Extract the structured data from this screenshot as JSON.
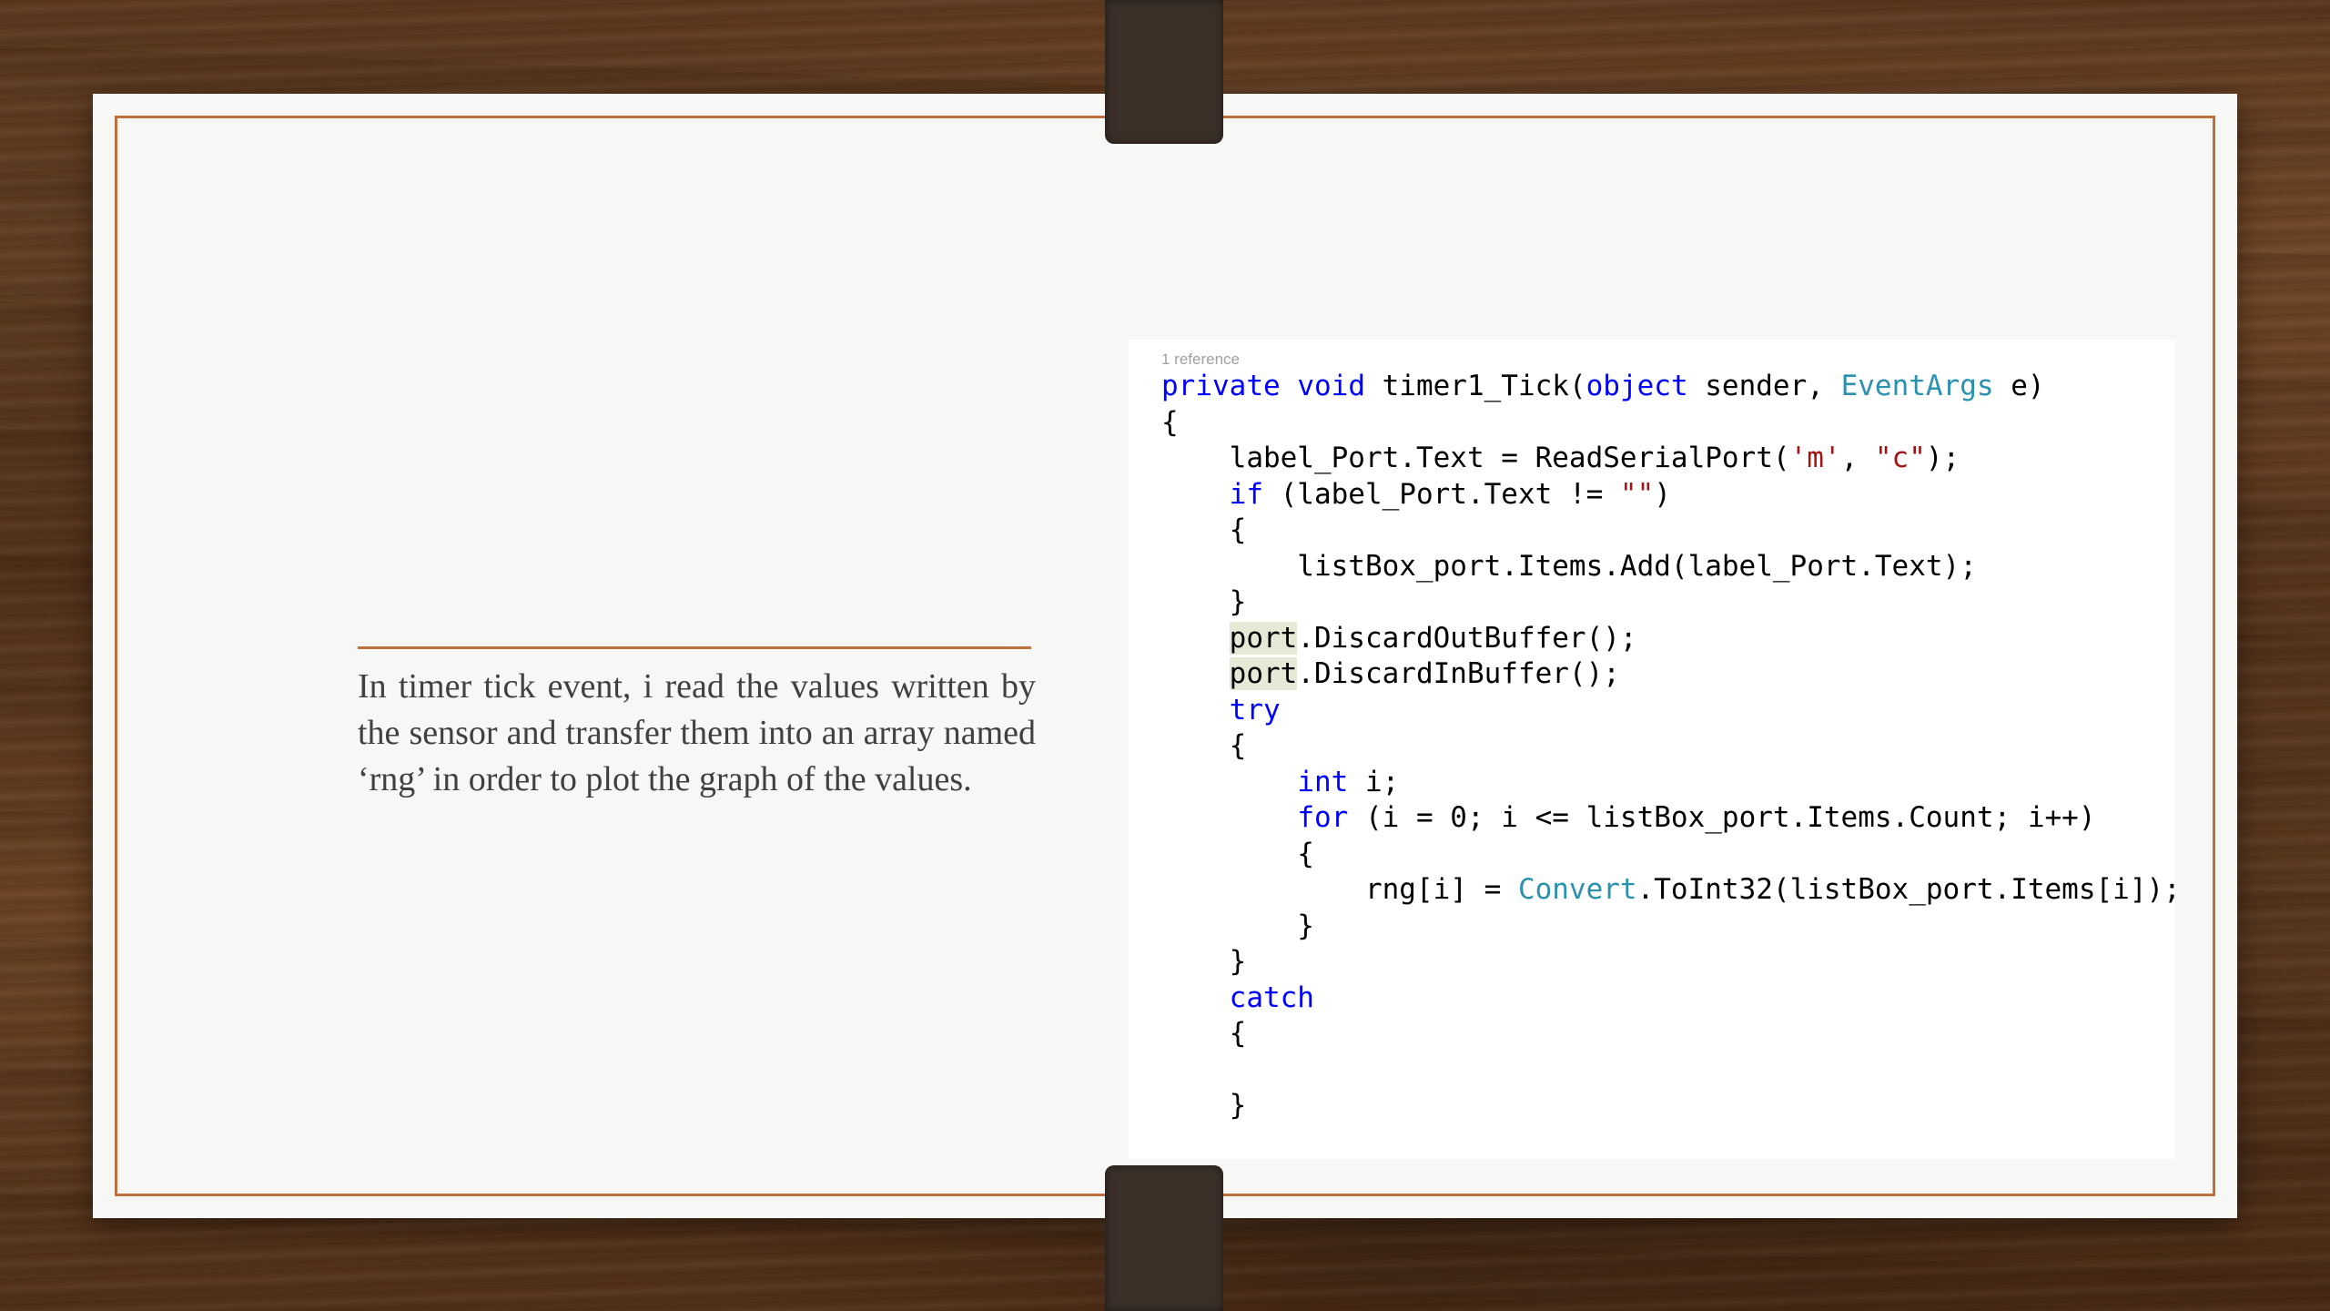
{
  "slide": {
    "description": "In timer tick event, i read the values written by the sensor and transfer them into an array named ‘rng’ in order to plot the graph of the values."
  },
  "code": {
    "reference": "1 reference",
    "lines": [
      [
        {
          "t": "private",
          "c": "kw"
        },
        {
          "t": " "
        },
        {
          "t": "void",
          "c": "kw"
        },
        {
          "t": " timer1_Tick("
        },
        {
          "t": "object",
          "c": "kw"
        },
        {
          "t": " sender, "
        },
        {
          "t": "EventArgs",
          "c": "ty"
        },
        {
          "t": " e)"
        }
      ],
      [
        {
          "t": "{"
        }
      ],
      [
        {
          "t": "    label_Port.Text = ReadSerialPort("
        },
        {
          "t": "'m'",
          "c": "st"
        },
        {
          "t": ", "
        },
        {
          "t": "\"c\"",
          "c": "st"
        },
        {
          "t": ");"
        }
      ],
      [
        {
          "t": "    "
        },
        {
          "t": "if",
          "c": "kw"
        },
        {
          "t": " (label_Port.Text != "
        },
        {
          "t": "\"\"",
          "c": "st"
        },
        {
          "t": ")"
        }
      ],
      [
        {
          "t": "    {"
        }
      ],
      [
        {
          "t": "        listBox_port.Items.Add(label_Port.Text);"
        }
      ],
      [
        {
          "t": "    }"
        }
      ],
      [
        {
          "t": "    "
        },
        {
          "t": "port",
          "c": "hl"
        },
        {
          "t": ".DiscardOutBuffer();"
        }
      ],
      [
        {
          "t": "    "
        },
        {
          "t": "port",
          "c": "hl"
        },
        {
          "t": ".DiscardInBuffer();"
        }
      ],
      [
        {
          "t": "    "
        },
        {
          "t": "try",
          "c": "kw"
        }
      ],
      [
        {
          "t": "    {"
        }
      ],
      [
        {
          "t": "        "
        },
        {
          "t": "int",
          "c": "kw"
        },
        {
          "t": " i;"
        }
      ],
      [
        {
          "t": "        "
        },
        {
          "t": "for",
          "c": "kw"
        },
        {
          "t": " (i = 0; i <= listBox_port.Items.Count; i++)"
        }
      ],
      [
        {
          "t": "        {"
        }
      ],
      [
        {
          "t": "            rng[i] = "
        },
        {
          "t": "Convert",
          "c": "ty"
        },
        {
          "t": ".ToInt32(listBox_port.Items[i]);"
        }
      ],
      [
        {
          "t": "        }"
        }
      ],
      [
        {
          "t": "    }"
        }
      ],
      [
        {
          "t": "    "
        },
        {
          "t": "catch",
          "c": "kw"
        }
      ],
      [
        {
          "t": "    {"
        }
      ],
      [
        {
          "t": ""
        }
      ],
      [
        {
          "t": "    }"
        }
      ]
    ]
  }
}
